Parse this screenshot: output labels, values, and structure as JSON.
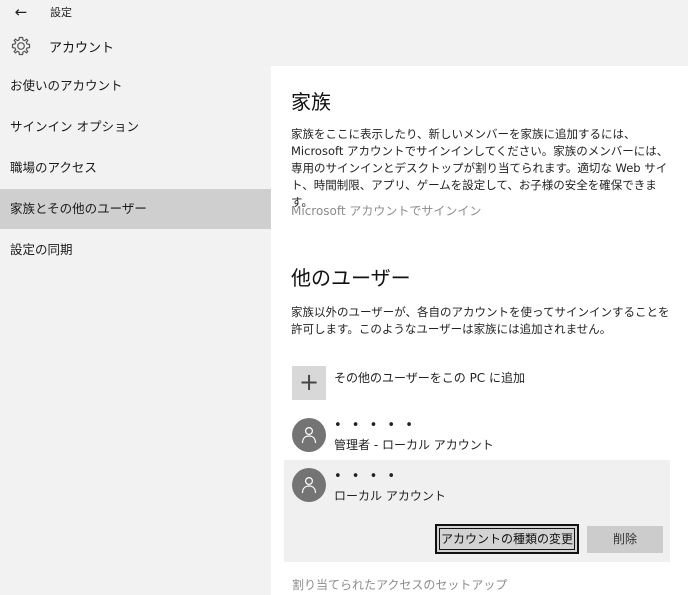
{
  "window": {
    "back_glyph": "←",
    "app_title": "設定",
    "page_title": "アカウント",
    "page_icon": "gear-icon"
  },
  "sidebar": {
    "items": [
      {
        "label": "お使いのアカウント",
        "selected": false
      },
      {
        "label": "サインイン オプション",
        "selected": false
      },
      {
        "label": "職場のアクセス",
        "selected": false
      },
      {
        "label": "家族とその他のユーザー",
        "selected": true
      },
      {
        "label": "設定の同期",
        "selected": false
      }
    ]
  },
  "family": {
    "heading": "家族",
    "description": "家族をここに表示したり、新しいメンバーを家族に追加するには、Microsoft アカウントでサインインしてください。家族のメンバーには、専用のサインインとデスクトップが割り当てられます。適切な Web サイト、時間制限、アプリ、ゲームを設定して、お子様の安全を確保できます。",
    "signin_link": "Microsoft アカウントでサインイン"
  },
  "other_users": {
    "heading": "他のユーザー",
    "description": "家族以外のユーザーが、各自のアカウントを使ってサインインすることを許可します。このようなユーザーは家族には追加されません。",
    "add_label": "その他のユーザーをこの PC に追加",
    "add_glyph": "+",
    "users": [
      {
        "name": "• • • • •",
        "subtitle": "管理者 - ローカル アカウント"
      },
      {
        "name": "• • • •",
        "subtitle": "ローカル アカウント"
      }
    ],
    "change_type_button": "アカウントの種類の変更",
    "delete_button": "削除"
  },
  "footer_link": "割り当てられたアクセスのセットアップ",
  "colors": {
    "sidebar_bg": "#f2f2f2",
    "selected_bg": "#cfcfcf",
    "avatar": "#747474",
    "link": "#8c8c8c"
  }
}
